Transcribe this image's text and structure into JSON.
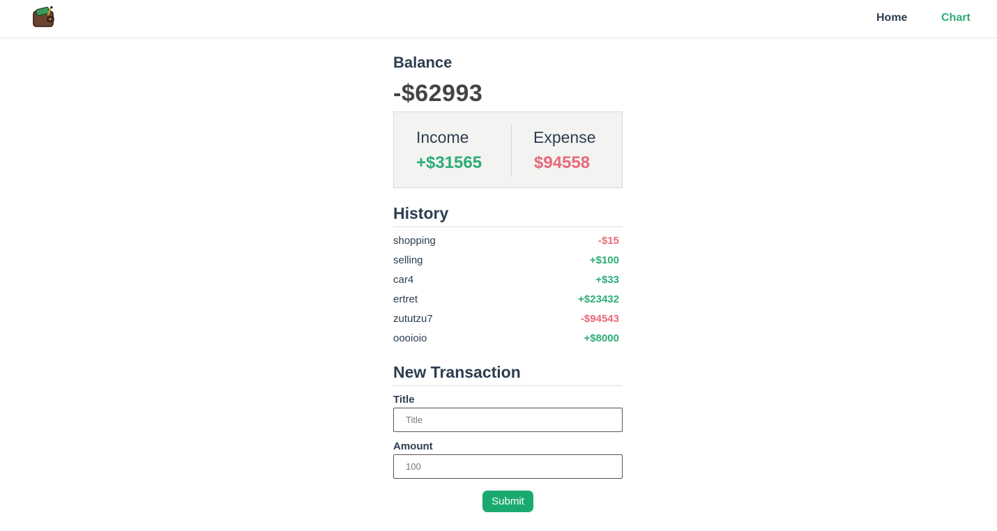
{
  "nav": {
    "logo": "wallet-icon",
    "home_label": "Home",
    "chart_label": "Chart"
  },
  "balance": {
    "label": "Balance",
    "value": "-$62993"
  },
  "summary": {
    "income_label": "Income",
    "income_value": "+$31565",
    "expense_label": "Expense",
    "expense_value": "$94558"
  },
  "history": {
    "title": "History",
    "items": [
      {
        "title": "shopping",
        "amount": "-$15",
        "type": "expense"
      },
      {
        "title": "selling",
        "amount": "+$100",
        "type": "income"
      },
      {
        "title": "car4",
        "amount": "+$33",
        "type": "income"
      },
      {
        "title": "ertret",
        "amount": "+$23432",
        "type": "income"
      },
      {
        "title": "zututzu7",
        "amount": "-$94543",
        "type": "expense"
      },
      {
        "title": "oooioio",
        "amount": "+$8000",
        "type": "income"
      }
    ]
  },
  "new_transaction": {
    "title": "New Transaction",
    "title_label": "Title",
    "title_placeholder": "Title",
    "title_value": "",
    "amount_label": "Amount",
    "amount_placeholder": "100",
    "amount_value": "",
    "submit_label": "Submit"
  },
  "colors": {
    "income": "#2eac75",
    "expense": "#e86a78",
    "accent": "#1aaa70",
    "text": "#2c3e50"
  }
}
